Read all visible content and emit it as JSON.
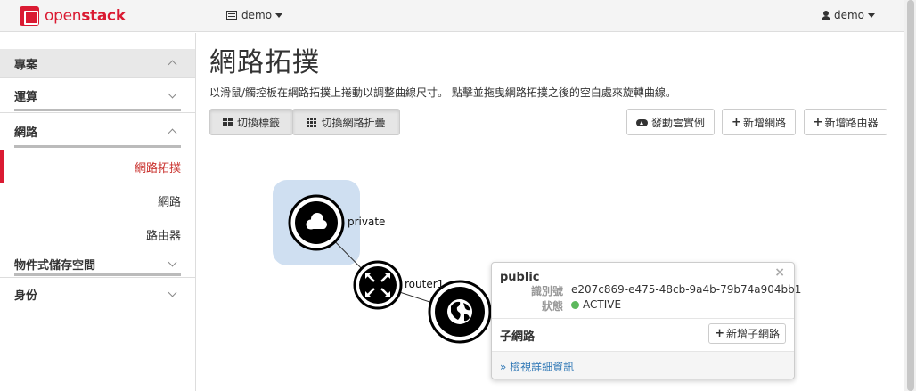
{
  "topbar": {
    "brand_open": "open",
    "brand_stack": "stack",
    "project": "demo",
    "user": "demo"
  },
  "sidebar": {
    "project": "專案",
    "compute": "運算",
    "network": "網路",
    "items": [
      {
        "label": "網路拓撲",
        "active": true
      },
      {
        "label": "網路",
        "active": false
      },
      {
        "label": "路由器",
        "active": false
      }
    ],
    "object_store": "物件式儲存空間",
    "identity": "身份"
  },
  "main": {
    "title": "網路拓撲",
    "subtitle": "以滑鼠/觸控板在網路拓撲上捲動以調整曲線尺寸。 點擊並拖曳網路拓撲之後的空白處來旋轉曲線。",
    "toggle_labels": "切換標籤",
    "toggle_collapse": "切換網路折疊",
    "launch_instance": "發動雲實例",
    "create_network": "新增網路",
    "create_router": "新增路由器"
  },
  "topology": {
    "private_label": "private",
    "router_label": "router1"
  },
  "popup": {
    "close": "×",
    "title": "public",
    "id_key": "識別號",
    "id_value": "e207c869-e475-48cb-9a4b-79b74a904bb1",
    "status_key": "狀態",
    "status_value": "ACTIVE",
    "subnet_heading": "子網路",
    "add_subnet": "新增子網路",
    "details_link": "» 檢視詳細資訊"
  },
  "colors": {
    "brand": "#da1a32",
    "active": "#c9302c",
    "status_ok": "#5cb85c",
    "link": "#337ab7",
    "private_highlight": "#cfdff1"
  }
}
